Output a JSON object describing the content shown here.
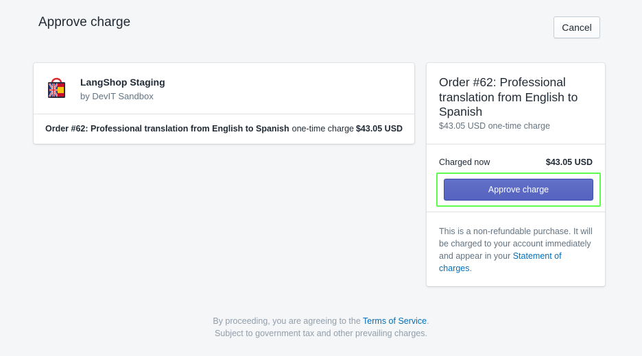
{
  "header": {
    "title": "Approve charge",
    "cancel_label": "Cancel"
  },
  "app": {
    "logo_icon": "langshop-bag-logo-icon",
    "name": "LangShop Staging",
    "developer": "by DevIT Sandbox",
    "line_item": {
      "description": "Order #62: Professional translation from English to Spanish",
      "charge_type": "one-time charge",
      "price": "$43.05 USD"
    }
  },
  "summary": {
    "title": "Order #62: Professional translation from English to Spanish",
    "subtitle": "$43.05 USD one-time charge",
    "charged_now_label": "Charged now",
    "charged_now_amount": "$43.05 USD",
    "approve_label": "Approve charge",
    "notice_text": "This is a non-refundable purchase. It will be charged to your account immediately and appear in your ",
    "notice_link": "Statement of charges",
    "notice_end": "."
  },
  "footer": {
    "line1_prefix": "By proceeding, you are agreeing to the ",
    "terms_link": "Terms of Service",
    "line1_suffix": ".",
    "line2": "Subject to government tax and other prevailing charges."
  },
  "colors": {
    "background": "#f4f6f8",
    "primary_button": "#5c6ac4",
    "link": "#006fbb",
    "highlight_border": "#5dfc4e"
  }
}
